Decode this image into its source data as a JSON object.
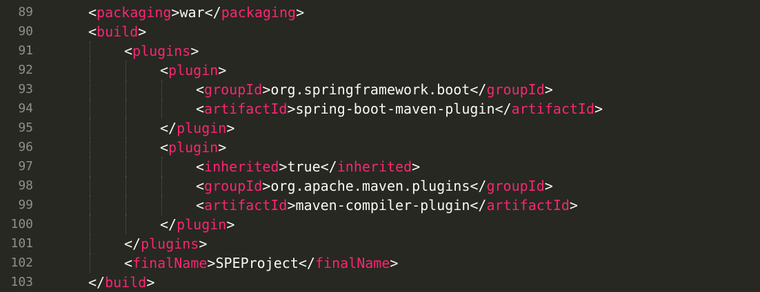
{
  "editor": {
    "lines": [
      {
        "no": "89",
        "indent": 1,
        "tokens": [
          [
            "p",
            "<"
          ],
          [
            "t",
            "packaging"
          ],
          [
            "p",
            ">"
          ],
          [
            "x",
            "war"
          ],
          [
            "p",
            "</"
          ],
          [
            "t",
            "packaging"
          ],
          [
            "p",
            ">"
          ]
        ]
      },
      {
        "no": "90",
        "indent": 1,
        "tokens": [
          [
            "p",
            "<"
          ],
          [
            "t",
            "build"
          ],
          [
            "p",
            ">"
          ]
        ]
      },
      {
        "no": "91",
        "indent": 2,
        "tokens": [
          [
            "p",
            "<"
          ],
          [
            "t",
            "plugins"
          ],
          [
            "p",
            ">"
          ]
        ]
      },
      {
        "no": "92",
        "indent": 3,
        "tokens": [
          [
            "p",
            "<"
          ],
          [
            "t",
            "plugin"
          ],
          [
            "p",
            ">"
          ]
        ]
      },
      {
        "no": "93",
        "indent": 4,
        "tokens": [
          [
            "p",
            "<"
          ],
          [
            "t",
            "groupId"
          ],
          [
            "p",
            ">"
          ],
          [
            "x",
            "org.springframework.boot"
          ],
          [
            "p",
            "</"
          ],
          [
            "t",
            "groupId"
          ],
          [
            "p",
            ">"
          ]
        ]
      },
      {
        "no": "94",
        "indent": 4,
        "tokens": [
          [
            "p",
            "<"
          ],
          [
            "t",
            "artifactId"
          ],
          [
            "p",
            ">"
          ],
          [
            "x",
            "spring-boot-maven-plugin"
          ],
          [
            "p",
            "</"
          ],
          [
            "t",
            "artifactId"
          ],
          [
            "p",
            ">"
          ]
        ]
      },
      {
        "no": "95",
        "indent": 3,
        "tokens": [
          [
            "p",
            "</"
          ],
          [
            "t",
            "plugin"
          ],
          [
            "p",
            ">"
          ]
        ]
      },
      {
        "no": "96",
        "indent": 3,
        "tokens": [
          [
            "p",
            "<"
          ],
          [
            "t",
            "plugin"
          ],
          [
            "p",
            ">"
          ]
        ]
      },
      {
        "no": "97",
        "indent": 4,
        "tokens": [
          [
            "p",
            "<"
          ],
          [
            "t",
            "inherited"
          ],
          [
            "p",
            ">"
          ],
          [
            "x",
            "true"
          ],
          [
            "p",
            "</"
          ],
          [
            "t",
            "inherited"
          ],
          [
            "p",
            ">"
          ]
        ]
      },
      {
        "no": "98",
        "indent": 4,
        "tokens": [
          [
            "p",
            "<"
          ],
          [
            "t",
            "groupId"
          ],
          [
            "p",
            ">"
          ],
          [
            "x",
            "org.apache.maven.plugins"
          ],
          [
            "p",
            "</"
          ],
          [
            "t",
            "groupId"
          ],
          [
            "p",
            ">"
          ]
        ]
      },
      {
        "no": "99",
        "indent": 4,
        "tokens": [
          [
            "p",
            "<"
          ],
          [
            "t",
            "artifactId"
          ],
          [
            "p",
            ">"
          ],
          [
            "x",
            "maven-compiler-plugin"
          ],
          [
            "p",
            "</"
          ],
          [
            "t",
            "artifactId"
          ],
          [
            "p",
            ">"
          ]
        ]
      },
      {
        "no": "100",
        "indent": 3,
        "tokens": [
          [
            "p",
            "</"
          ],
          [
            "t",
            "plugin"
          ],
          [
            "p",
            ">"
          ]
        ]
      },
      {
        "no": "101",
        "indent": 2,
        "tokens": [
          [
            "p",
            "</"
          ],
          [
            "t",
            "plugins"
          ],
          [
            "p",
            ">"
          ]
        ]
      },
      {
        "no": "102",
        "indent": 2,
        "tokens": [
          [
            "p",
            "<"
          ],
          [
            "t",
            "finalName"
          ],
          [
            "p",
            ">"
          ],
          [
            "x",
            "SPEProject"
          ],
          [
            "p",
            "</"
          ],
          [
            "t",
            "finalName"
          ],
          [
            "p",
            ">"
          ]
        ]
      },
      {
        "no": "103",
        "indent": 1,
        "tokens": [
          [
            "p",
            "</"
          ],
          [
            "t",
            "build"
          ],
          [
            "p",
            ">"
          ]
        ]
      }
    ]
  },
  "colors": {
    "background": "#272822",
    "tag": "#f92672",
    "text": "#f8f8f2",
    "line_number": "#90908a"
  }
}
